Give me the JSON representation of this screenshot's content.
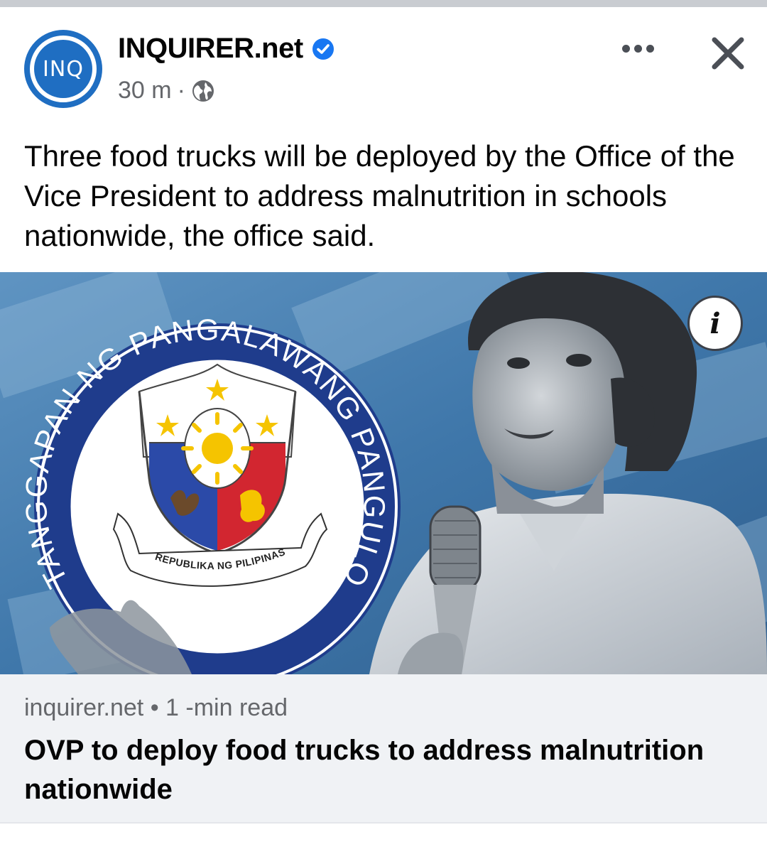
{
  "post": {
    "page_name": "INQUIRER.net",
    "avatar_text": "INQ",
    "time": "30 m",
    "separator": "·",
    "caption": "Three food trucks will be deployed by the Office of the Vice President to address malnutrition in schools nationwide, the office said."
  },
  "image": {
    "seal_ring_text": "TANGGAPAN NG PANGALAWANG PANGULO",
    "seal_banner_text": "REPUBLIKA NG PILIPINAS",
    "info_glyph": "i"
  },
  "link_preview": {
    "source": "inquirer.net",
    "dot": "•",
    "read_time": "1 -min read",
    "title": "OVP to deploy food trucks to address malnutrition nationwide"
  },
  "icons": {
    "verified": "verified-badge-icon",
    "audience": "globe-icon",
    "more": "more-options-icon",
    "close": "close-icon",
    "info": "info-icon"
  },
  "colors": {
    "brand_blue": "#1f6ec2",
    "verified_blue": "#1877f2",
    "secondary_text": "#65676b",
    "preview_bg": "#f0f2f5",
    "seal_ring": "#1f3c8c",
    "flag_blue": "#2b4aa8",
    "flag_red": "#d22630",
    "sun_yellow": "#f5c400"
  }
}
